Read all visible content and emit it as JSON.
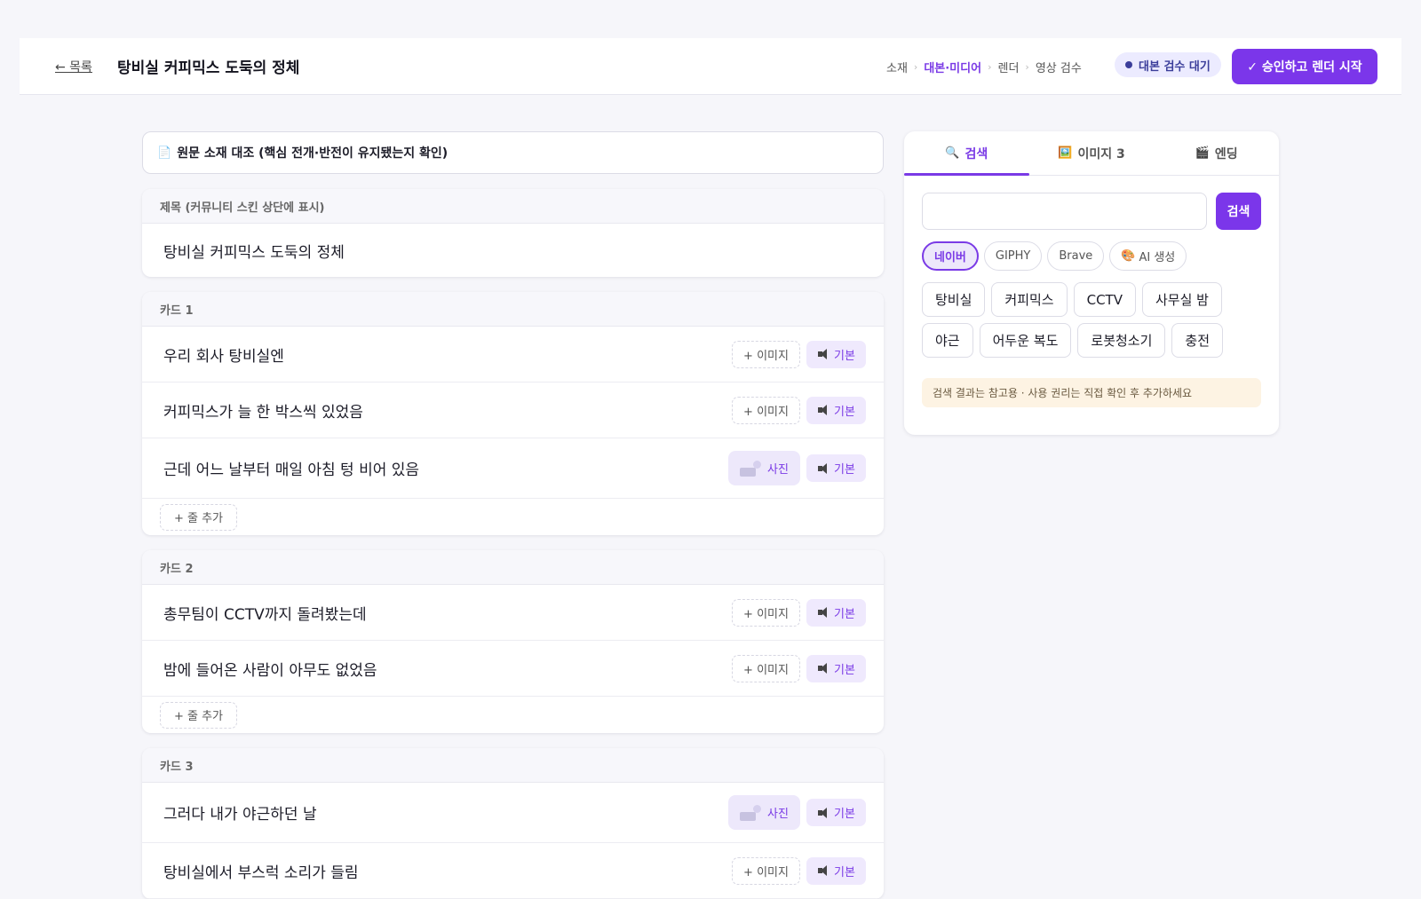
{
  "header": {
    "back_label": "← 목록",
    "title": "탕비실 커피믹스 도둑의 정체",
    "steps": [
      "소재",
      "대본·미디어",
      "렌더",
      "영상 검수"
    ],
    "active_step": 1,
    "status": "대본 검수 대기",
    "approve_label": "✓ 승인하고 렌더 시작"
  },
  "compare": {
    "icon": "📄",
    "label": "원문 소재 대조 (핵심 전개·반전이 유지됐는지 확인)"
  },
  "title_card": {
    "heading": "제목 (커뮤니티 스킨 상단에 표시)",
    "value": "탕비실 커피믹스 도둑의 정체"
  },
  "cards": [
    {
      "heading": "카드 1",
      "lines": [
        {
          "text": "우리 회사 탕비실엔",
          "media": "이미지"
        },
        {
          "text": "커피믹스가 늘 한 박스씩 있었음",
          "media": "이미지"
        },
        {
          "text": "근데 어느 날부터 매일 아침 텅 비어 있음",
          "media": "사진"
        }
      ]
    },
    {
      "heading": "카드 2",
      "lines": [
        {
          "text": "총무팀이 CCTV까지 돌려봤는데",
          "media": "이미지"
        },
        {
          "text": "밤에 들어온 사람이 아무도 없었음",
          "media": "이미지"
        }
      ]
    },
    {
      "heading": "카드 3",
      "lines": [
        {
          "text": "그러다 내가 야근하던 날",
          "media": "사진"
        },
        {
          "text": "탕비실에서 부스럭 소리가 들림",
          "media": "이미지"
        }
      ]
    }
  ],
  "line_buttons": {
    "image_label": "+ 이미지",
    "photo_label": "사진",
    "voice_label": "기본"
  },
  "add_line_label": "+ 줄 추가",
  "panel": {
    "tabs": [
      {
        "icon": "🔍",
        "label": "검색"
      },
      {
        "icon": "🖼️",
        "label": "이미지 3"
      },
      {
        "icon": "🎬",
        "label": "엔딩"
      }
    ],
    "search_value": "",
    "search_button": "검색",
    "sources": [
      {
        "label": "네이버",
        "active": true
      },
      {
        "label": "GIPHY",
        "active": false
      },
      {
        "label": "Brave",
        "active": false
      },
      {
        "label": "AI 생성",
        "icon": "🎨",
        "active": false
      }
    ],
    "keywords": [
      "탕비실",
      "커피믹스",
      "CCTV",
      "사무실 밤",
      "야근",
      "어두운 복도",
      "로봇청소기",
      "충전"
    ],
    "notice": "검색 결과는 참고용 · 사용 권리는 직접 확인 후 추가하세요"
  },
  "colors": {
    "accent": "#7b36ea",
    "status_bg": "#ecebff",
    "notice_bg": "#fdf3e3"
  }
}
